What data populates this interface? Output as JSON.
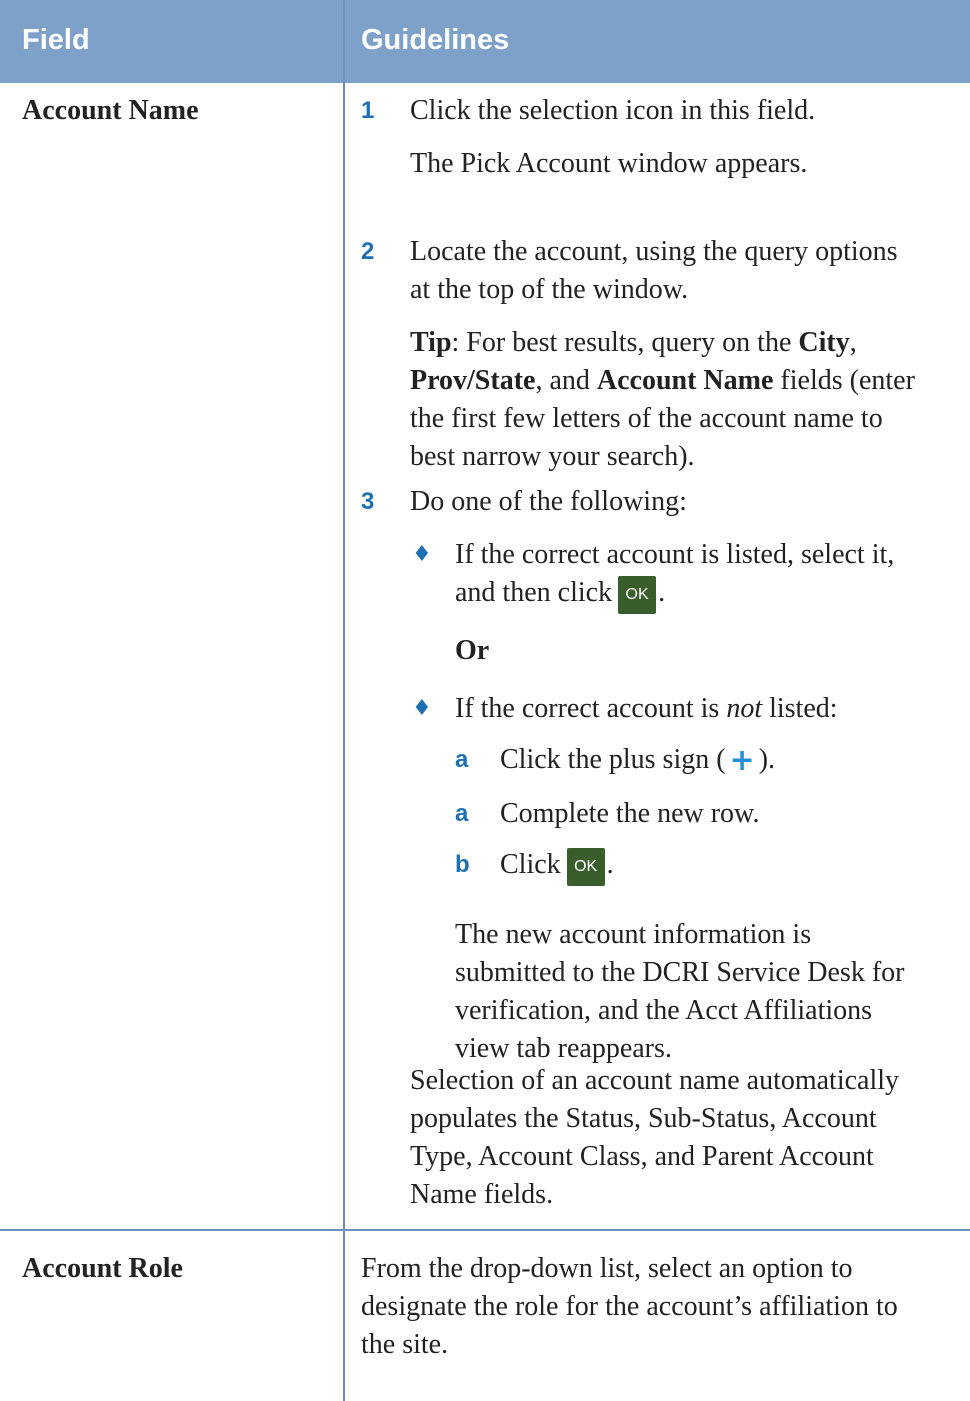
{
  "table": {
    "header": {
      "field": "Field",
      "guidelines": "Guidelines"
    },
    "row1": {
      "field": "Account Name",
      "step1": {
        "num": "1",
        "text": "Click the selection icon in this field.",
        "result": "The Pick Account window appears."
      },
      "step2": {
        "num": "2",
        "line1": "Locate the account, using the query options",
        "line2": "at the top of the window.",
        "tip_label": "Tip",
        "tip_l1_a": ": For best results, query on the ",
        "tip_city": "City",
        "tip_l1_b": ",",
        "tip_prov": "Prov/State",
        "tip_l2_a": ", and ",
        "tip_acct": "Account Name",
        "tip_l2_b": " fields (enter",
        "tip_l3": "the first few letters of the account name to",
        "tip_l4": "best narrow your search)."
      },
      "step3": {
        "num": "3",
        "text": "Do one of the following:",
        "opt1_l1": "If the correct account is listed, select it,",
        "opt1_l2": "and then click",
        "opt1_l2_end": ".",
        "or_label": "Or",
        "opt2_a": "If the correct account is ",
        "opt2_em": "not",
        "opt2_b": " listed:",
        "sub_a_letter": "a",
        "sub_a_text_1": "Click the plus sign (",
        "sub_a_text_2": ").",
        "sub_a2_letter": "a",
        "sub_a2_text": "Complete the new row.",
        "sub_b_letter": "b",
        "sub_b_text": "Click",
        "sub_b_end": ".",
        "result_l1": "The new account information is",
        "result_l2": "submitted to the DCRI Service Desk for",
        "result_l3": "verification, and the Acct Affiliations",
        "result_l4": "view tab reappears."
      },
      "note_l1": "Selection of an account name automatically",
      "note_l2": "populates the Status, Sub-Status, Account",
      "note_l3": "Type, Account Class, and Parent Account",
      "note_l4": "Name fields."
    },
    "row2": {
      "field": "Account Role",
      "l1": "From the drop-down list, select an option to",
      "l2": "designate the role for the account’s affiliation to",
      "l3": "the site."
    }
  },
  "buttons": {
    "ok_label": "OK"
  },
  "icons": {
    "plus": "plus-icon",
    "bullet": "diamond-bullet-icon",
    "ok": "ok-button"
  },
  "colors": {
    "header_bg": "#7ea1ca",
    "accent_blue": "#1f6fb5",
    "ok_green": "#3a5e2b",
    "rule": "#6a8fbd"
  }
}
